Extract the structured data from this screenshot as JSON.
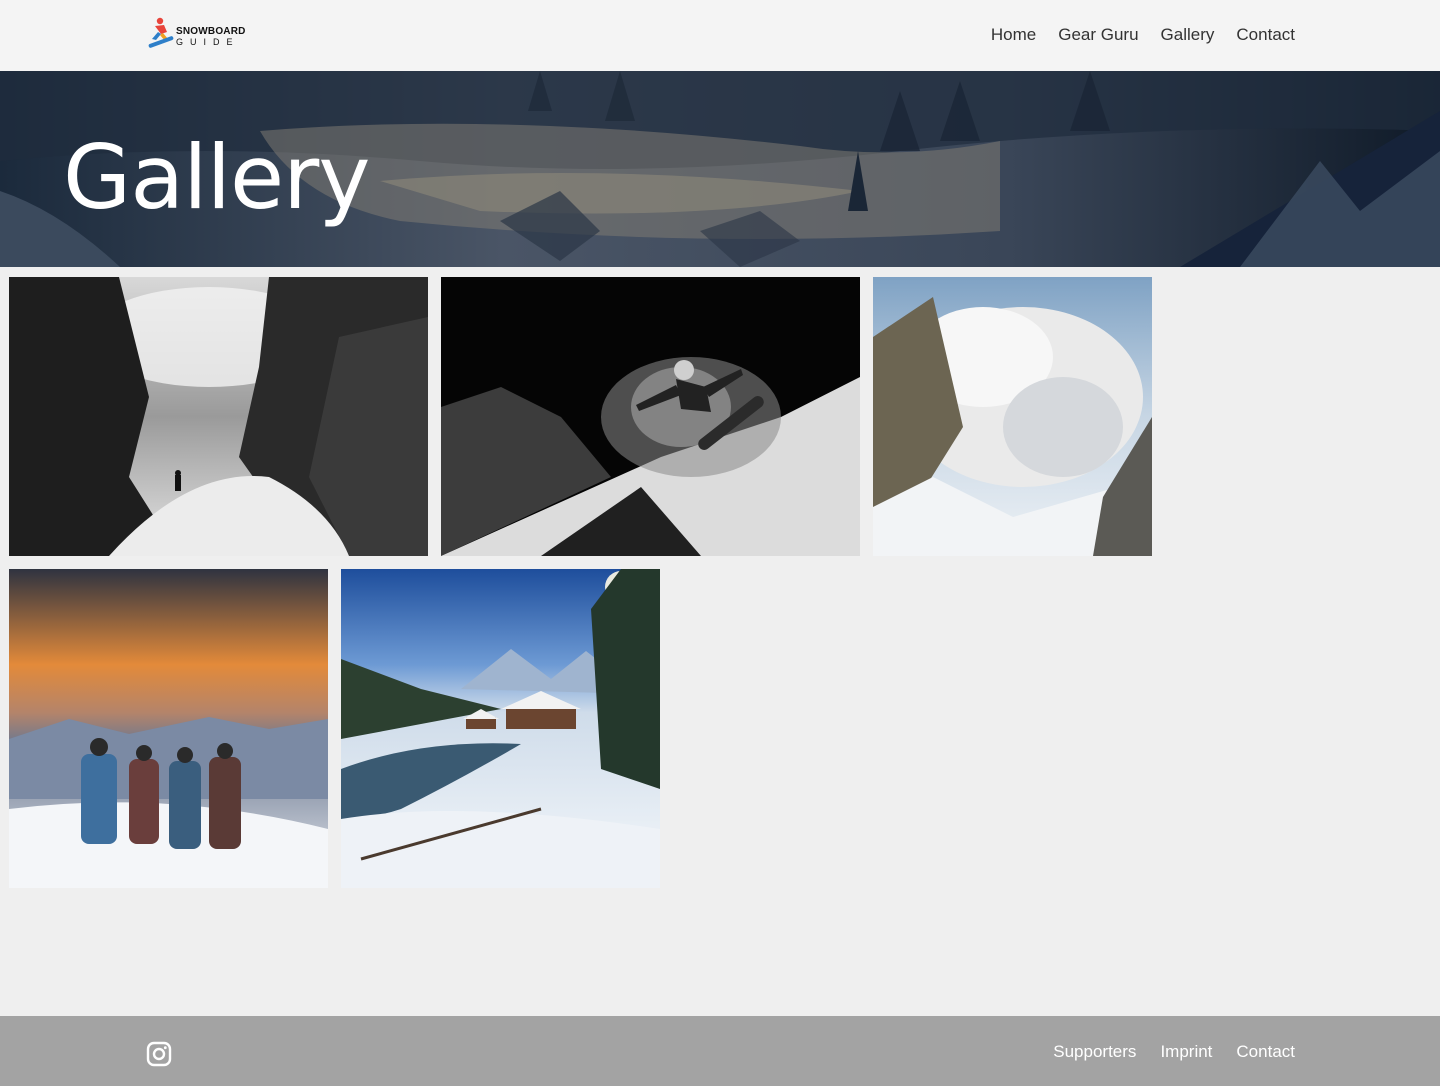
{
  "header": {
    "logo_title": "SNOWBOARD",
    "logo_subtitle": "GUIDE",
    "nav": [
      "Home",
      "Gear Guru",
      "Gallery",
      "Contact"
    ]
  },
  "hero": {
    "title": "Gallery"
  },
  "gallery": {
    "images": [
      "backcountry-hiker-bw",
      "snowboard-jump-bw",
      "avalanche",
      "group-sunset",
      "cabin-creek"
    ]
  },
  "footer": {
    "social_icon": "instagram-icon",
    "links": [
      "Supporters",
      "Imprint",
      "Contact"
    ]
  }
}
